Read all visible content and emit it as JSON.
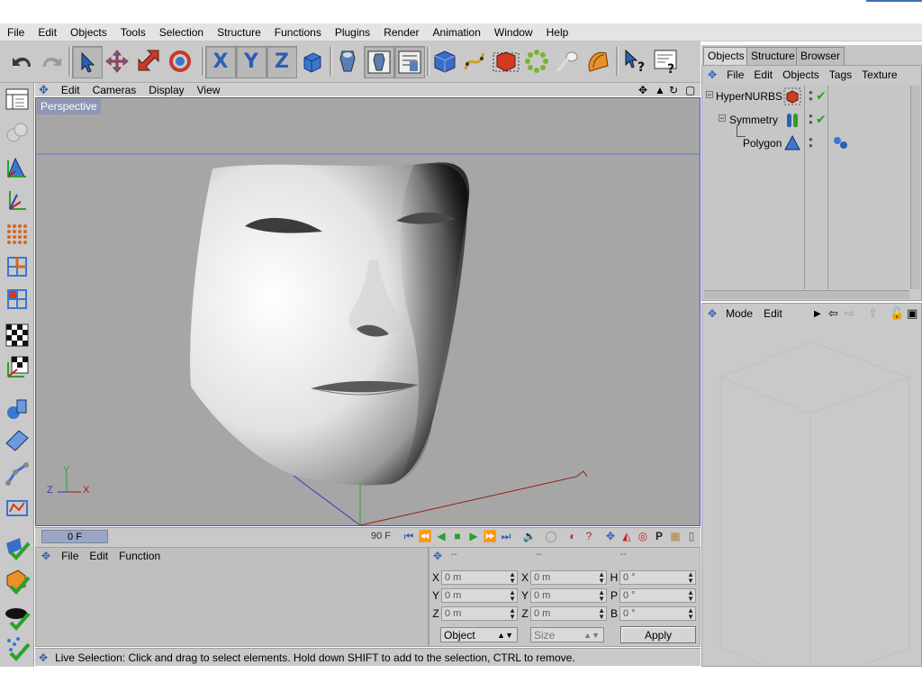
{
  "menubar": {
    "items": [
      "File",
      "Edit",
      "Objects",
      "Tools",
      "Selection",
      "Structure",
      "Functions",
      "Plugins",
      "Render",
      "Animation",
      "Window",
      "Help"
    ]
  },
  "toolbar": {
    "buttons": [
      {
        "name": "undo-icon",
        "glyph": "↶"
      },
      {
        "name": "redo-icon",
        "glyph": "↷"
      },
      {
        "name": "live-selection-icon",
        "glyph": "➚"
      },
      {
        "name": "move-icon",
        "glyph": "✥"
      },
      {
        "name": "scale-icon",
        "glyph": "⇱"
      },
      {
        "name": "rotate-icon",
        "glyph": "⟳"
      },
      {
        "name": "x-axis-lock-icon",
        "label": "X"
      },
      {
        "name": "y-axis-lock-icon",
        "label": "Y"
      },
      {
        "name": "z-axis-lock-icon",
        "label": "Z"
      },
      {
        "name": "coordinate-system-icon",
        "glyph": "◈"
      },
      {
        "name": "render-view-icon",
        "glyph": "⛫"
      },
      {
        "name": "render-picture-viewer-icon",
        "glyph": "⛫"
      },
      {
        "name": "render-settings-icon",
        "glyph": "▤"
      },
      {
        "name": "cube-object-icon",
        "glyph": "■"
      },
      {
        "name": "spline-icon",
        "glyph": "✎"
      },
      {
        "name": "nurbs-icon",
        "glyph": "◆"
      },
      {
        "name": "array-icon",
        "glyph": "✲"
      },
      {
        "name": "light-icon",
        "glyph": "✦"
      },
      {
        "name": "deformer-icon",
        "glyph": "◖"
      },
      {
        "name": "help-pointer-icon",
        "glyph": "?"
      },
      {
        "name": "help-text-icon",
        "glyph": "?"
      }
    ]
  },
  "viewport": {
    "menu": [
      "Edit",
      "Cameras",
      "Display",
      "View"
    ],
    "camera_label": "Perspective",
    "axis_labels": {
      "y": "Y",
      "z": "Z",
      "x": "X"
    }
  },
  "timeline": {
    "current_frame": "0 F",
    "end_frame": "90 F"
  },
  "bottom_left": {
    "menu": [
      "File",
      "Edit",
      "Function"
    ]
  },
  "coordinates": {
    "header_dashes": [
      "--",
      "--",
      "--"
    ],
    "rows": [
      {
        "l1": "X",
        "v1": "0 m",
        "l2": "X",
        "v2": "0 m",
        "l3": "H",
        "v3": "0 °"
      },
      {
        "l1": "Y",
        "v1": "0 m",
        "l2": "Y",
        "v2": "0 m",
        "l3": "P",
        "v3": "0 °"
      },
      {
        "l1": "Z",
        "v1": "0 m",
        "l2": "Z",
        "v2": "0 m",
        "l3": "B",
        "v3": "0 °"
      }
    ],
    "mode_select": "Object",
    "size_select": "Size",
    "apply_label": "Apply"
  },
  "status": {
    "text": "Live Selection: Click and drag to select elements. Hold down SHIFT to add to the selection, CTRL to remove."
  },
  "right_tabs": [
    "Objects",
    "Structure",
    "Browser"
  ],
  "object_manager": {
    "menu": [
      "File",
      "Edit",
      "Objects",
      "Tags",
      "Texture"
    ],
    "objects": [
      {
        "name": "HyperNURBS",
        "depth": 0
      },
      {
        "name": "Symmetry",
        "depth": 1
      },
      {
        "name": "Polygon",
        "depth": 2
      }
    ]
  },
  "attribute_manager": {
    "menu": [
      "Mode",
      "Edit"
    ]
  },
  "colors": {
    "viewport_bg": "#a6a6a6",
    "viewport_border": "#4a53c7",
    "x_axis": "#9b1a1a",
    "y_axis": "#2aa02a",
    "z_axis": "#3a3ab0"
  }
}
